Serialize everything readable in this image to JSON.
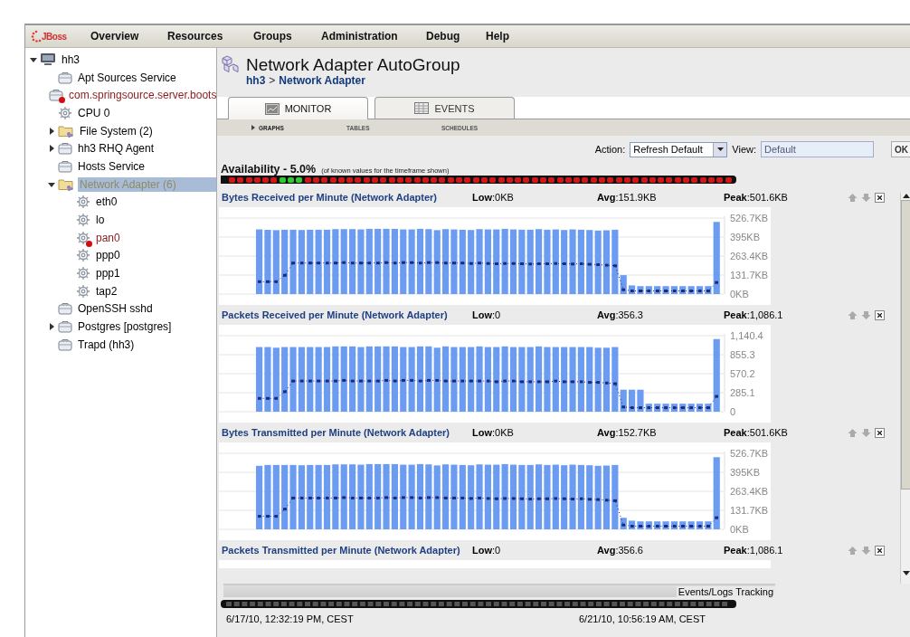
{
  "nav": {
    "logo": "JBoss",
    "items": [
      "Overview",
      "Resources",
      "Groups",
      "Administration",
      "Debug",
      "Help"
    ]
  },
  "tree": [
    {
      "label": "hh3",
      "kind": "platform",
      "expanded": true,
      "selected": false,
      "error": false,
      "children": [
        {
          "label": "Apt Sources Service",
          "kind": "service",
          "selected": false,
          "error": false
        },
        {
          "label": "com.springsource.server.boots",
          "kind": "service",
          "selected": false,
          "error": true
        },
        {
          "label": "CPU 0",
          "kind": "gear",
          "selected": false,
          "error": false
        },
        {
          "label": "File System (2)",
          "kind": "group",
          "expanded": false,
          "selected": false,
          "error": false
        },
        {
          "label": "hh3 RHQ Agent",
          "kind": "service",
          "expanded": false,
          "selected": false,
          "error": false
        },
        {
          "label": "Hosts Service",
          "kind": "service",
          "selected": false,
          "error": false
        },
        {
          "label": "Network Adapter (6)",
          "kind": "group",
          "expanded": true,
          "selected": true,
          "error": false,
          "children": [
            {
              "label": "eth0",
              "kind": "gear",
              "selected": false,
              "error": false
            },
            {
              "label": "lo",
              "kind": "gear",
              "selected": false,
              "error": false
            },
            {
              "label": "pan0",
              "kind": "gear",
              "selected": false,
              "error": true
            },
            {
              "label": "ppp0",
              "kind": "gear",
              "selected": false,
              "error": false
            },
            {
              "label": "ppp1",
              "kind": "gear",
              "selected": false,
              "error": false
            },
            {
              "label": "tap2",
              "kind": "gear",
              "selected": false,
              "error": false
            }
          ]
        },
        {
          "label": "OpenSSH sshd",
          "kind": "service",
          "selected": false,
          "error": false
        },
        {
          "label": "Postgres [postgres]",
          "kind": "service",
          "expanded": false,
          "selected": false,
          "error": false
        },
        {
          "label": "Trapd (hh3)",
          "kind": "service",
          "selected": false,
          "error": false
        }
      ]
    }
  ],
  "header": {
    "title": "Network Adapter AutoGroup",
    "breadcrumb": [
      "hh3",
      "Network Adapter"
    ],
    "separator": ">"
  },
  "tabs": [
    {
      "label": "MONITOR",
      "kind": "monitor",
      "selected": true
    },
    {
      "label": "EVENTS",
      "kind": "events",
      "selected": false
    }
  ],
  "subtabs": [
    {
      "label": "GRAPHS",
      "selected": true
    },
    {
      "label": "TABLES",
      "selected": false
    },
    {
      "label": "SCHEDULES",
      "selected": false
    }
  ],
  "action_bar": {
    "action_label": "Action:",
    "action_value": "Refresh Default",
    "view_label": "View:",
    "view_value": "Default",
    "ok": "OK"
  },
  "availability": {
    "label": "Availability - 5.0%",
    "note": "(of known values for the timeframe shown)",
    "slots": [
      false,
      false,
      false,
      false,
      false,
      false,
      true,
      true,
      true,
      false,
      false,
      false,
      false,
      false,
      false,
      false,
      false,
      false,
      false,
      false,
      false,
      false,
      false,
      false,
      false,
      false,
      false,
      false,
      false,
      false,
      false,
      false,
      false,
      false,
      false,
      false,
      false,
      false,
      false,
      false,
      false,
      false,
      false,
      false,
      false,
      false,
      false,
      false,
      false,
      false,
      false,
      false,
      false,
      false,
      false,
      false,
      false,
      false,
      false,
      false
    ]
  },
  "metrics": [
    {
      "title": "Bytes Received per Minute (Network Adapter)",
      "low": "**Low**:0KB",
      "avg": "**Avg**:151.9KB",
      "peak": "**Peak**:501.6KB",
      "chart_data": {
        "type": "bar",
        "grid": true,
        "ylim": [
          0,
          526.7
        ],
        "yticks": [
          {
            "value": 0,
            "label": "0KB"
          },
          {
            "value": 131.7,
            "label": "131.7KB"
          },
          {
            "value": 263.4,
            "label": "263.4KB"
          },
          {
            "value": 395,
            "label": "395KB"
          },
          {
            "value": 526.7,
            "label": "526.7KB"
          }
        ],
        "series": [
          {
            "color": "#6b9cf2",
            "values": [
              448,
              445,
              443,
              446,
              446,
              444,
              446,
              446,
              446,
              450,
              450,
              450,
              448,
              452,
              452,
              452,
              452,
              448,
              448,
              452,
              450,
              443,
              450,
              448,
              446,
              444,
              450,
              448,
              448,
              452,
              448,
              446,
              446,
              450,
              446,
              448,
              444,
              448,
              446,
              444,
              440,
              442,
              446,
              131,
              60,
              55,
              55,
              55,
              55,
              55,
              55,
              55,
              55,
              55,
              500
            ]
          }
        ]
      },
      "average_line": {
        "chart_data": {
          "type": "line",
          "ylim": [
            0,
            526.7
          ],
          "series": [
            {
              "color": "#1c2a78",
              "line_style": "dotted",
              "values": [
                86,
                86,
                86,
                130,
                215,
                215,
                215,
                215,
                215,
                215,
                218,
                215,
                215,
                215,
                215,
                218,
                215,
                218,
                218,
                215,
                218,
                218,
                215,
                215,
                215,
                212,
                215,
                212,
                210,
                212,
                212,
                210,
                208,
                210,
                210,
                212,
                210,
                208,
                210,
                206,
                204,
                200,
                196,
                30,
                22,
                22,
                22,
                22,
                22,
                22,
                22,
                22,
                22,
                22,
                80
              ]
            }
          ]
        }
      }
    },
    {
      "title": "Packets Received per Minute (Network Adapter)",
      "low": "**Low**:0",
      "avg": "**Avg**:356.3",
      "peak": "**Peak**:1,086.1",
      "chart_data": {
        "type": "bar",
        "grid": true,
        "ylim": [
          0,
          1140.4
        ],
        "yticks": [
          {
            "value": 0,
            "label": "0"
          },
          {
            "value": 285.1,
            "label": "285.1"
          },
          {
            "value": 570.2,
            "label": "570.2"
          },
          {
            "value": 855.3,
            "label": "855.3"
          },
          {
            "value": 1140.4,
            "label": "1,140.4"
          }
        ],
        "series": [
          {
            "color": "#6b9cf2",
            "values": [
              970,
              970,
              960,
              970,
              970,
              970,
              970,
              970,
              970,
              980,
              980,
              980,
              970,
              980,
              980,
              980,
              980,
              970,
              970,
              980,
              980,
              960,
              980,
              970,
              970,
              970,
              980,
              970,
              970,
              980,
              970,
              970,
              970,
              980,
              970,
              970,
              970,
              970,
              970,
              970,
              960,
              960,
              970,
              330,
              330,
              330,
              120,
              120,
              120,
              120,
              120,
              120,
              120,
              120,
              1090
            ]
          }
        ]
      },
      "average_line": {
        "chart_data": {
          "type": "line",
          "ylim": [
            0,
            1140.4
          ],
          "series": [
            {
              "color": "#1c2a78",
              "line_style": "dotted",
              "values": [
                200,
                200,
                200,
                300,
                460,
                460,
                460,
                460,
                460,
                460,
                470,
                460,
                460,
                460,
                460,
                470,
                460,
                470,
                470,
                460,
                470,
                470,
                460,
                460,
                460,
                460,
                460,
                460,
                450,
                460,
                460,
                450,
                450,
                450,
                450,
                460,
                450,
                450,
                450,
                440,
                440,
                430,
                420,
                70,
                60,
                60,
                60,
                60,
                60,
                60,
                60,
                60,
                60,
                60,
                230
              ]
            }
          ]
        }
      }
    },
    {
      "title": "Bytes Transmitted per Minute (Network Adapter)",
      "low": "**Low**:0KB",
      "avg": "**Avg**:152.7KB",
      "peak": "**Peak**:501.6KB",
      "chart_data": {
        "type": "bar",
        "grid": true,
        "ylim": [
          0,
          526.7
        ],
        "yticks": [
          {
            "value": 0,
            "label": "0KB"
          },
          {
            "value": 131.7,
            "label": "131.7KB"
          },
          {
            "value": 263.4,
            "label": "263.4KB"
          },
          {
            "value": 395,
            "label": "395KB"
          },
          {
            "value": 526.7,
            "label": "526.7KB"
          }
        ],
        "series": [
          {
            "color": "#6b9cf2",
            "values": [
              440,
              446,
              446,
              446,
              446,
              444,
              446,
              446,
              446,
              450,
              450,
              450,
              448,
              452,
              452,
              452,
              452,
              448,
              448,
              452,
              450,
              443,
              450,
              448,
              446,
              444,
              450,
              448,
              448,
              452,
              448,
              446,
              446,
              450,
              446,
              448,
              444,
              448,
              446,
              444,
              440,
              442,
              446,
              80,
              60,
              55,
              55,
              55,
              55,
              55,
              55,
              55,
              55,
              55,
              500
            ]
          }
        ]
      },
      "average_line": {
        "chart_data": {
          "type": "line",
          "ylim": [
            0,
            526.7
          ],
          "series": [
            {
              "color": "#1c2a78",
              "line_style": "dotted",
              "values": [
                90,
                90,
                90,
                140,
                217,
                217,
                217,
                217,
                217,
                217,
                220,
                217,
                217,
                217,
                217,
                220,
                217,
                220,
                220,
                217,
                220,
                220,
                217,
                217,
                217,
                214,
                217,
                214,
                212,
                214,
                214,
                212,
                210,
                212,
                212,
                214,
                212,
                210,
                212,
                208,
                206,
                202,
                198,
                30,
                22,
                22,
                22,
                22,
                22,
                22,
                22,
                22,
                22,
                22,
                80
              ]
            }
          ]
        }
      }
    },
    {
      "title": "Packets Transmitted per Minute (Network Adapter)",
      "low": "**Low**:0",
      "avg": "**Avg**:356.6",
      "peak": "**Peak**:1,086.1"
    }
  ],
  "footer": {
    "events_label": "Events/Logs Tracking",
    "start": "6/17/10, 12:32:19 PM, CEST",
    "end": "6/21/10, 10:56:19 AM, CEST"
  }
}
